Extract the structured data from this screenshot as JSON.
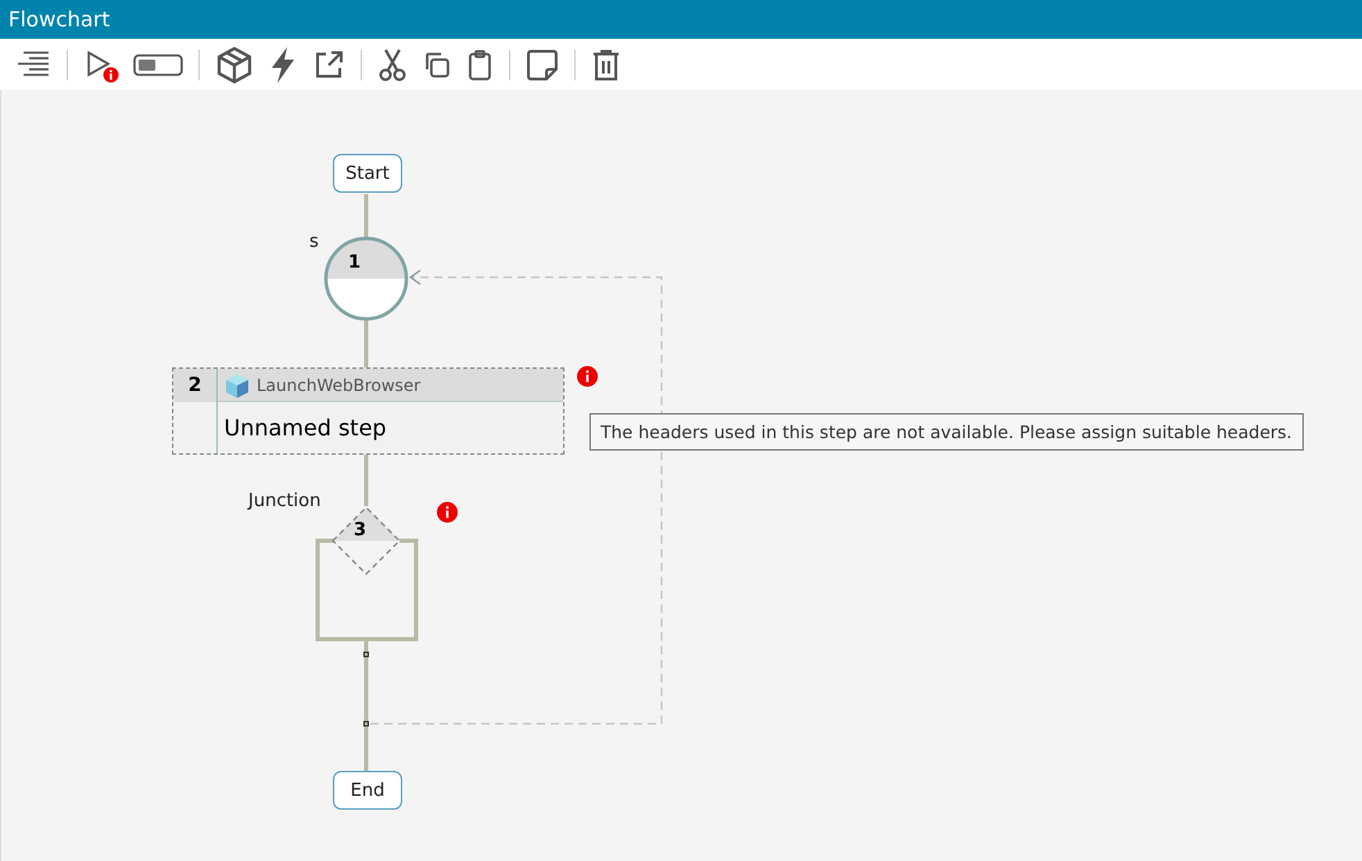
{
  "window": {
    "title": "Flowchart"
  },
  "toolbar": {
    "run_has_error": true
  },
  "flow": {
    "start": "Start",
    "end": "End",
    "step1": {
      "number": "1",
      "label": "s"
    },
    "step2": {
      "number": "2",
      "action": "LaunchWebBrowser",
      "name": "Unnamed step",
      "has_error": true
    },
    "tooltip": "The headers used in this step are not available. Please assign suitable headers.",
    "junction": {
      "number": "3",
      "label": "Junction",
      "has_error": true
    }
  }
}
